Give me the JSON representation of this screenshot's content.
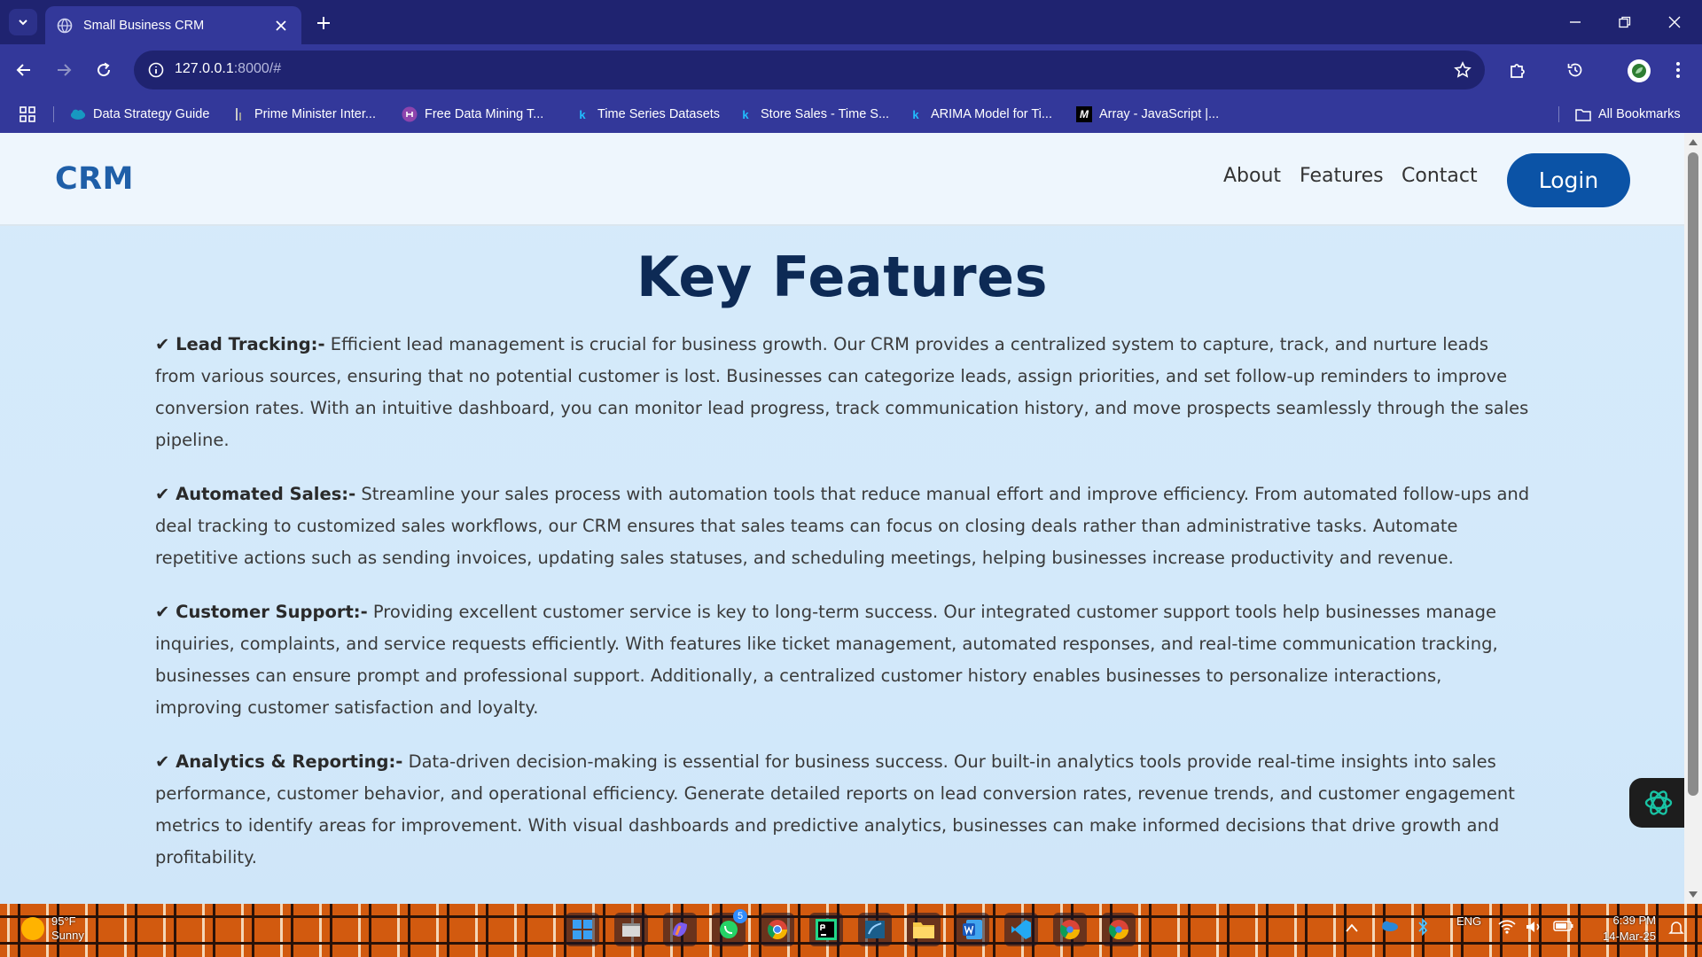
{
  "browser": {
    "tab": {
      "title": "Small Business CRM",
      "favicon": "globe-icon"
    },
    "url": {
      "host": "127.0.0.1",
      "rest": ":8000/#"
    },
    "bookmarks": [
      {
        "label": "Data Strategy Guide",
        "icon": "salesforce-cloud-icon"
      },
      {
        "label": "Prime Minister Inter...",
        "icon": "site-icon"
      },
      {
        "label": "Free Data Mining T...",
        "icon": "purple-logo-icon"
      },
      {
        "label": "Time Series Datasets",
        "icon": "kaggle-icon"
      },
      {
        "label": "Store Sales - Time S...",
        "icon": "kaggle-icon"
      },
      {
        "label": "ARIMA Model for Ti...",
        "icon": "kaggle-icon"
      },
      {
        "label": "Array - JavaScript |...",
        "icon": "mdn-icon"
      }
    ],
    "all_bookmarks": "All Bookmarks"
  },
  "site": {
    "brand": "CRM",
    "nav": [
      "About",
      "Features",
      "Contact"
    ],
    "login": "Login",
    "heading": "Key Features",
    "features": [
      {
        "title": "✔ Lead Tracking:-",
        "body": " Efficient lead management is crucial for business growth. Our CRM provides a centralized system to capture, track, and nurture leads from various sources, ensuring that no potential customer is lost. Businesses can categorize leads, assign priorities, and set follow-up reminders to improve conversion rates. With an intuitive dashboard, you can monitor lead progress, track communication history, and move prospects seamlessly through the sales pipeline."
      },
      {
        "title": "✔ Automated Sales:-",
        "body": " Streamline your sales process with automation tools that reduce manual effort and improve efficiency. From automated follow-ups and deal tracking to customized sales workflows, our CRM ensures that sales teams can focus on closing deals rather than administrative tasks. Automate repetitive actions such as sending invoices, updating sales statuses, and scheduling meetings, helping businesses increase productivity and revenue."
      },
      {
        "title": "✔ Customer Support:-",
        "body": " Providing excellent customer service is key to long-term success. Our integrated customer support tools help businesses manage inquiries, complaints, and service requests efficiently. With features like ticket management, automated responses, and real-time communication tracking, businesses can ensure prompt and professional support. Additionally, a centralized customer history enables businesses to personalize interactions, improving customer satisfaction and loyalty."
      },
      {
        "title": "✔ Analytics & Reporting:-",
        "body": " Data-driven decision-making is essential for business success. Our built-in analytics tools provide real-time insights into sales performance, customer behavior, and operational efficiency. Generate detailed reports on lead conversion rates, revenue trends, and customer engagement metrics to identify areas for improvement. With visual dashboards and predictive analytics, businesses can make informed decisions that drive growth and profitability."
      }
    ]
  },
  "taskbar": {
    "weather": {
      "temp": "95°F",
      "condition": "Sunny"
    },
    "whatsapp_badge": "5",
    "language": "ENG",
    "time": "6:39 PM",
    "date": "14-Mar-25"
  }
}
